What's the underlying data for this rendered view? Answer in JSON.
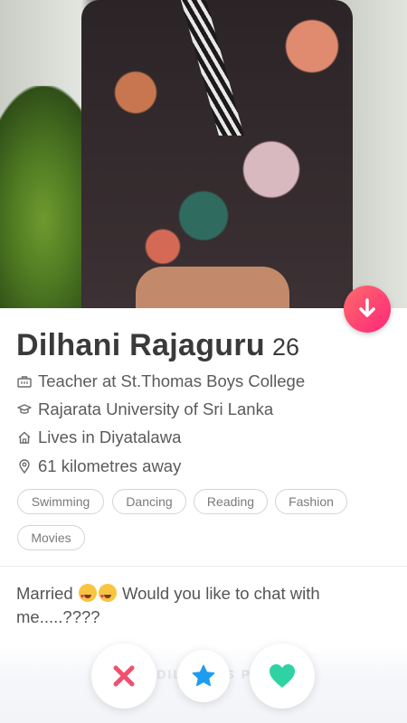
{
  "profile": {
    "name": "Dilhani Rajaguru",
    "age": "26",
    "job": "Teacher at St.Thomas Boys College",
    "school": "Rajarata University of Sri Lanka",
    "location": "Lives in Diyatalawa",
    "distance": "61 kilometres away",
    "interests": [
      "Swimming",
      "Dancing",
      "Reading",
      "Fashion",
      "Movies"
    ],
    "bio_prefix": "Married",
    "bio_suffix": " Would you like to chat with me.....????"
  },
  "footer": {
    "share_label": "SHARE DILHANI'S PROFILE"
  },
  "icons": {
    "collapse": "arrow-down-icon",
    "job": "briefcase-icon",
    "school": "graduation-cap-icon",
    "home": "house-icon",
    "distance": "location-pin-icon",
    "nope": "x-icon",
    "super_like": "star-icon",
    "like": "heart-icon",
    "emoji": "heart-eyes-emoji-icon"
  },
  "colors": {
    "accent_gradient_start": "#ff6b6b",
    "accent_gradient_end": "#fd267a",
    "nope": "#f0506e",
    "super_like": "#1e9df0",
    "like": "#2fd3a3"
  }
}
